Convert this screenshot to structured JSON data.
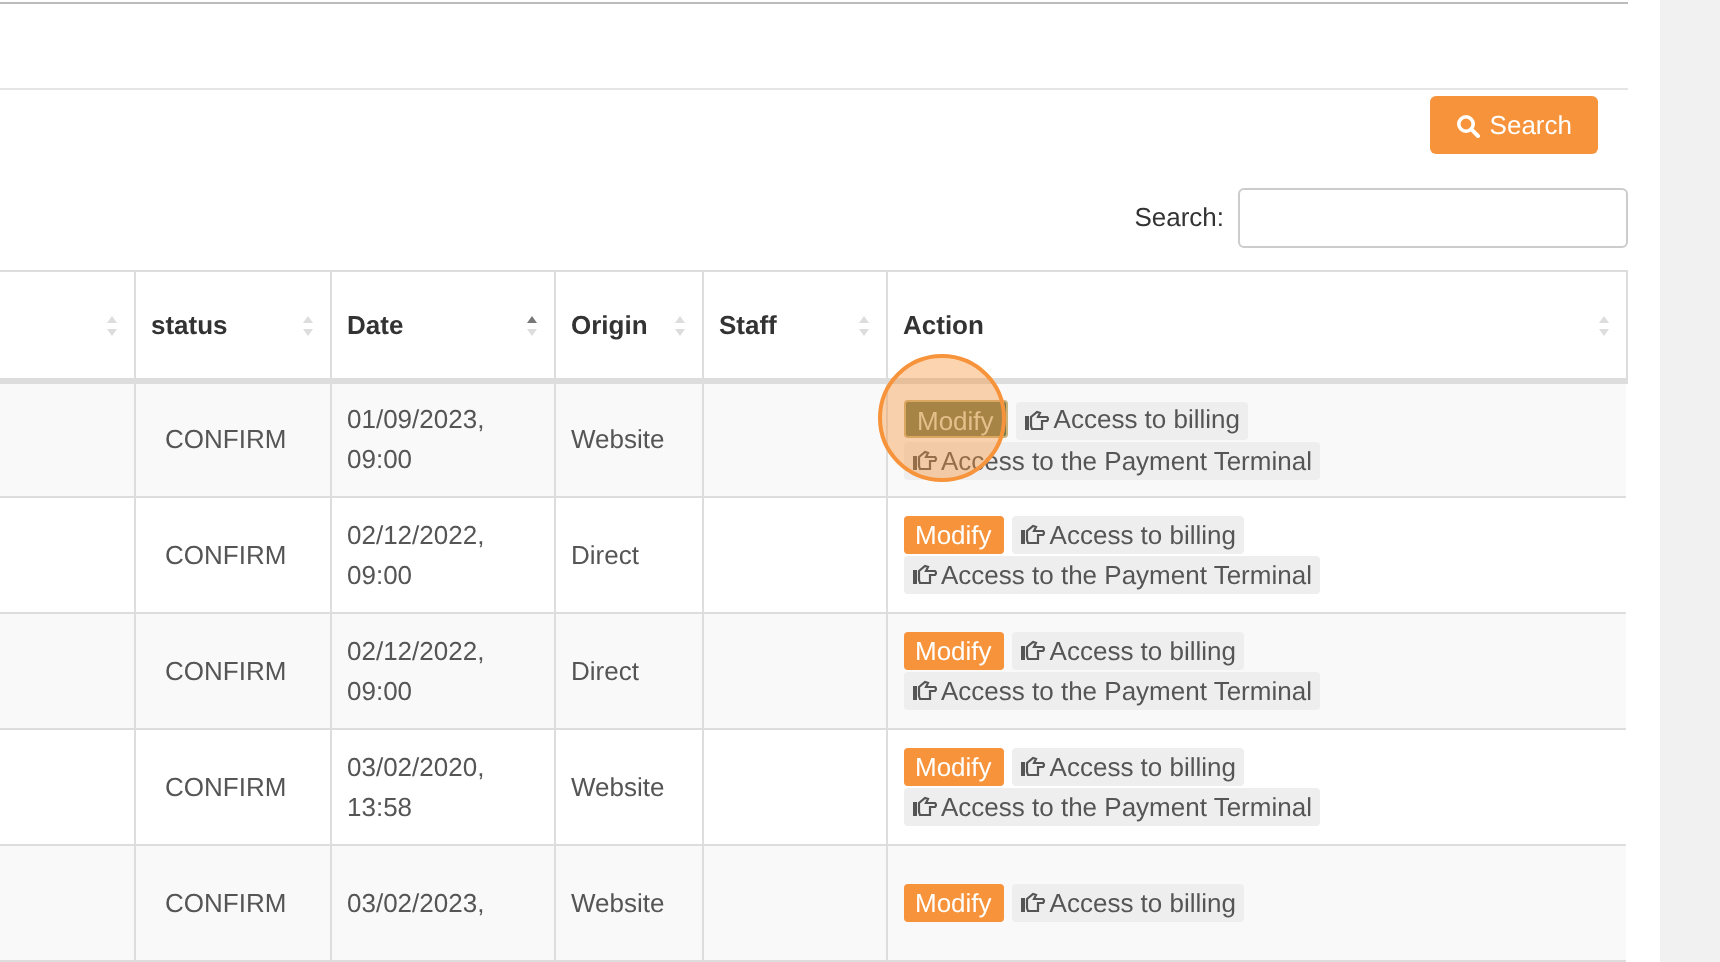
{
  "toolbar": {
    "search_button": "Search"
  },
  "filter": {
    "label": "Search:"
  },
  "table": {
    "columns": [
      {
        "sorted": false
      },
      {
        "label": "status",
        "sorted": false
      },
      {
        "label": "Date",
        "sorted": true
      },
      {
        "label": "Origin",
        "sorted": false
      },
      {
        "label": "Staff",
        "sorted": false
      },
      {
        "label": "Action",
        "sorted": false
      }
    ],
    "rows": [
      {
        "status": "CONFIRM",
        "date": [
          "01/09/2023,",
          "09:00"
        ],
        "origin": "Website",
        "actions": {
          "modify": "Modify",
          "highlighted": true,
          "billing": "Access to billing",
          "terminal": "Access to the Payment Terminal"
        }
      },
      {
        "status": "CONFIRM",
        "date": [
          "02/12/2022,",
          "09:00"
        ],
        "origin": "Direct",
        "actions": {
          "modify": "Modify",
          "highlighted": false,
          "billing": "Access to billing",
          "terminal": "Access to the Payment Terminal"
        }
      },
      {
        "status": "CONFIRM",
        "date": [
          "02/12/2022,",
          "09:00"
        ],
        "origin": "Direct",
        "actions": {
          "modify": "Modify",
          "highlighted": false,
          "billing": "Access to billing",
          "terminal": "Access to the Payment Terminal"
        }
      },
      {
        "status": "CONFIRM",
        "date": [
          "03/02/2020,",
          "13:58"
        ],
        "origin": "Website",
        "actions": {
          "modify": "Modify",
          "highlighted": false,
          "billing": "Access to billing",
          "terminal": "Access to the Payment Terminal"
        }
      },
      {
        "status": "CONFIRM",
        "date": [
          "03/02/2023,"
        ],
        "origin": "Website",
        "actions": {
          "modify": "Modify",
          "highlighted": false,
          "billing": "Access to billing"
        }
      }
    ]
  }
}
